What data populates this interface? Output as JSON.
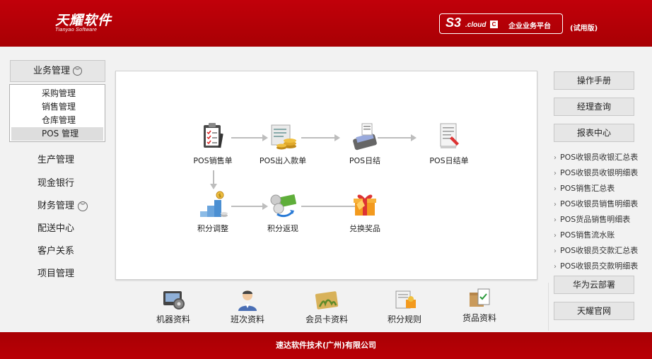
{
  "header": {
    "logo_cn": "天耀软件",
    "logo_en": "Tianyao Software",
    "brand_s3": "S3",
    "brand_cloud": ".cloud",
    "brand_c": "C",
    "brand_platform": "企业业务平台",
    "trial": "(试用版)"
  },
  "sidebar": {
    "category": "业务管理",
    "submenu": [
      "采购管理",
      "销售管理",
      "仓库管理",
      "POS 管理"
    ],
    "active_submenu": "POS 管理",
    "items": [
      "生产管理",
      "现金银行",
      "财务管理",
      "配送中心",
      "客户关系",
      "项目管理"
    ]
  },
  "flow": {
    "row1": [
      "POS销售单",
      "POS出入款单",
      "POS日结",
      "POS日结单"
    ],
    "row2": [
      "积分调整",
      "积分返现",
      "兑换奖品"
    ]
  },
  "toolbar": [
    "机器资料",
    "班次资料",
    "会员卡资料",
    "积分规则",
    "货品资料"
  ],
  "right": {
    "btn_manual": "操作手册",
    "btn_manager": "经理查询",
    "btn_reports": "报表中心",
    "reports": [
      "POS收银员收银汇总表",
      "POS收银员收银明细表",
      "POS销售汇总表",
      "POS收银员销售明细表",
      "POS货品销售明细表",
      "POS销售流水账",
      "POS收银员交款汇总表",
      "POS收银员交款明细表"
    ],
    "btn_huawei": "华为云部署",
    "btn_site": "天耀官网"
  },
  "footer": "速达软件技术(广州)有限公司",
  "colors": {
    "brand_red": "#b80005",
    "panel_bg": "#ffffff",
    "page_bg": "#f2f2f2"
  }
}
